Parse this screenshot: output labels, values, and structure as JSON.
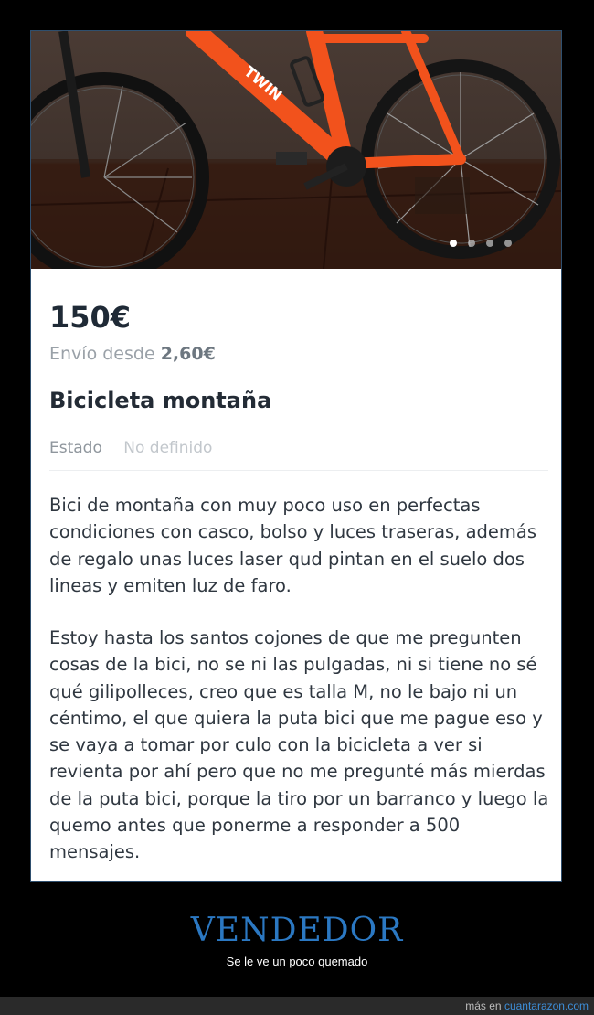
{
  "listing": {
    "price": "150€",
    "shipping_prefix": "Envío desde",
    "shipping_amount": "2,60€",
    "title": "Bicicleta montaña",
    "status_label": "Estado",
    "status_value": "No definido",
    "description_p1": "Bici de montaña con muy poco uso en perfectas condiciones con casco, bolso y luces traseras, además de regalo unas luces laser qud pintan en el suelo dos lineas y emiten luz de faro.",
    "description_p2": "Estoy hasta los santos cojones de que me pregunten cosas de la bici, no se ni las pulgadas, ni si tiene no sé qué gilipolleces, creo que es talla M, no le bajo ni un céntimo, el que quiera la puta bici que me pague eso y se vaya a tomar por culo con la bicicleta a ver si revienta por ahí pero que no me pregunté más mierdas de la puta bici, porque la tiro por un barranco y luego la quemo antes que ponerme a responder a 500 mensajes.",
    "image_carousel": {
      "total": 4,
      "active": 1
    }
  },
  "caption": {
    "title": "VENDEDOR",
    "subtitle": "Se le ve un poco quemado"
  },
  "footer": {
    "prefix": "más en",
    "site": "cuantarazon.com"
  },
  "colors": {
    "bike_orange": "#f2521c",
    "caption_blue": "#2b78c2",
    "link_blue": "#3d8ed8"
  }
}
